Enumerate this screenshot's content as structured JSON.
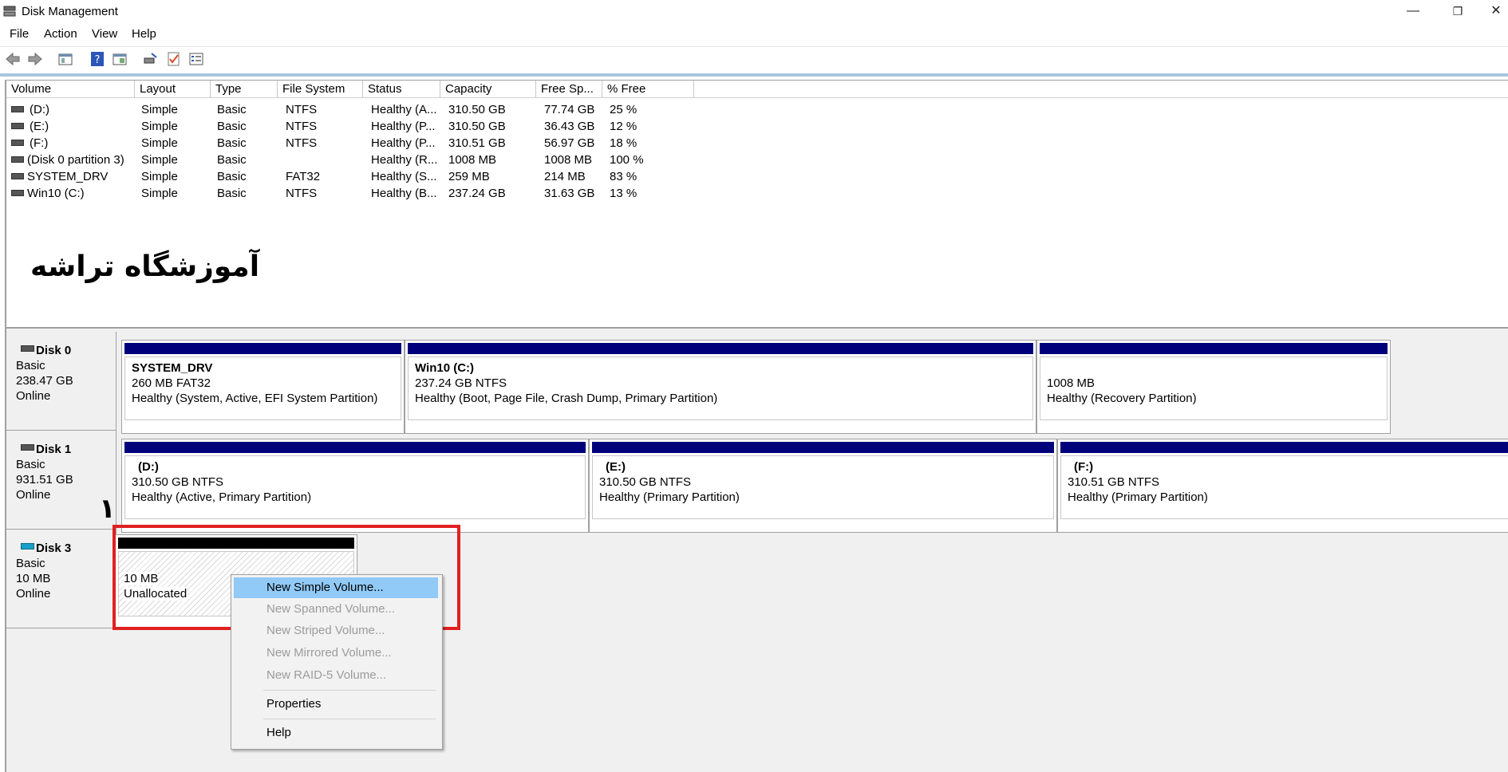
{
  "window": {
    "title": "Disk Management",
    "minimize": "—",
    "restore": "❐",
    "close": "✕"
  },
  "menu": [
    "File",
    "Action",
    "View",
    "Help"
  ],
  "toolbar": [
    "back-icon",
    "forward-icon",
    "console-tree-icon",
    "help-icon",
    "properties-icon",
    "rescan-icon",
    "check-icon",
    "list-icon"
  ],
  "volumes": {
    "columns": [
      "Volume",
      "Layout",
      "Type",
      "File System",
      "Status",
      "Capacity",
      "Free Sp...",
      "% Free"
    ],
    "rows": [
      [
        "(D:)",
        "Simple",
        "Basic",
        "NTFS",
        "Healthy (A...",
        "310.50 GB",
        "77.74 GB",
        "25 %"
      ],
      [
        "(E:)",
        "Simple",
        "Basic",
        "NTFS",
        "Healthy (P...",
        "310.50 GB",
        "36.43 GB",
        "12 %"
      ],
      [
        "(F:)",
        "Simple",
        "Basic",
        "NTFS",
        "Healthy (P...",
        "310.51 GB",
        "56.97 GB",
        "18 %"
      ],
      [
        "(Disk 0 partition 3)",
        "Simple",
        "Basic",
        "",
        "Healthy (R...",
        "1008 MB",
        "1008 MB",
        "100 %"
      ],
      [
        "SYSTEM_DRV",
        "Simple",
        "Basic",
        "FAT32",
        "Healthy (S...",
        "259 MB",
        "214 MB",
        "83 %"
      ],
      [
        "Win10 (C:)",
        "Simple",
        "Basic",
        "NTFS",
        "Healthy (B...",
        "237.24 GB",
        "31.63 GB",
        "13 %"
      ]
    ]
  },
  "watermark": "آموزشگاه تراشه",
  "marker": "۱",
  "disks": [
    {
      "name": "Disk 0",
      "type": "Basic",
      "size": "238.47 GB",
      "status": "Online",
      "partitions": [
        {
          "name": "SYSTEM_DRV",
          "size": "260 MB FAT32",
          "status": "Healthy (System, Active, EFI System Partition)"
        },
        {
          "name": "Win10  (C:)",
          "size": "237.24 GB NTFS",
          "status": "Healthy (Boot, Page File, Crash Dump, Primary Partition)"
        },
        {
          "name": "",
          "size": "1008 MB",
          "status": "Healthy (Recovery Partition)"
        }
      ]
    },
    {
      "name": "Disk 1",
      "type": "Basic",
      "size": "931.51 GB",
      "status": "Online",
      "partitions": [
        {
          "name": "(D:)",
          "size": "310.50 GB NTFS",
          "status": "Healthy (Active, Primary Partition)"
        },
        {
          "name": "(E:)",
          "size": "310.50 GB NTFS",
          "status": "Healthy (Primary Partition)"
        },
        {
          "name": "(F:)",
          "size": "310.51 GB NTFS",
          "status": "Healthy (Primary Partition)"
        }
      ]
    },
    {
      "name": "Disk 3",
      "type": "Basic",
      "size": "10 MB",
      "status": "Online",
      "unallocated": {
        "size": "10 MB",
        "label": "Unallocated"
      }
    }
  ],
  "context_menu": {
    "items": [
      {
        "label": "New Simple Volume...",
        "enabled": true,
        "selected": true
      },
      {
        "label": "New Spanned Volume...",
        "enabled": false
      },
      {
        "label": "New Striped Volume...",
        "enabled": false
      },
      {
        "label": "New Mirrored Volume...",
        "enabled": false
      },
      {
        "label": "New RAID-5 Volume...",
        "enabled": false
      },
      {
        "label": "Properties",
        "enabled": true
      },
      {
        "label": "Help",
        "enabled": true
      }
    ]
  },
  "colors": {
    "primary_partition_bar": "#00007b",
    "unallocated_bar": "#000000",
    "highlight": "#91c9f7",
    "red_box": "#e02020"
  }
}
